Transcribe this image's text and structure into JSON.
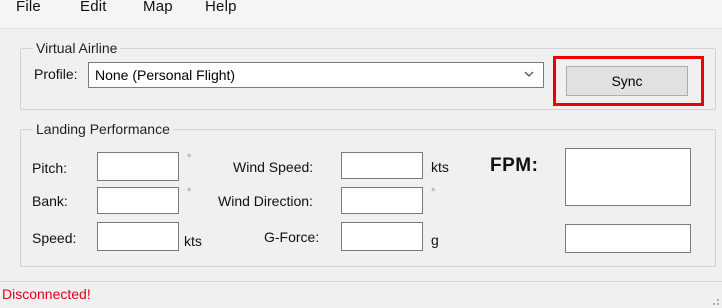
{
  "menu": {
    "file": "File",
    "edit": "Edit",
    "map": "Map",
    "help": "Help"
  },
  "virtual_airline": {
    "title": "Virtual Airline",
    "profile_label": "Profile:",
    "profile_value": "None (Personal Flight)",
    "sync_label": "Sync"
  },
  "landing": {
    "title": "Landing Performance",
    "pitch_label": "Pitch:",
    "bank_label": "Bank:",
    "speed_label": "Speed:",
    "wind_speed_label": "Wind Speed:",
    "wind_direction_label": "Wind Direction:",
    "gforce_label": "G-Force:",
    "degree_unit": "°",
    "kts_unit": "kts",
    "g_unit": "g",
    "fpm_label": "FPM:",
    "pitch_value": "",
    "bank_value": "",
    "speed_value": "",
    "wind_speed_value": "",
    "wind_direction_value": "",
    "gforce_value": "",
    "fpm_value": "",
    "fpm_secondary_value": ""
  },
  "status": {
    "text": "Disconnected!"
  },
  "colors": {
    "status_error": "#e0001b",
    "highlight": "#e00000"
  },
  "icons": {
    "dropdown": "chevron-down-icon",
    "grip": "resize-grip-icon"
  }
}
